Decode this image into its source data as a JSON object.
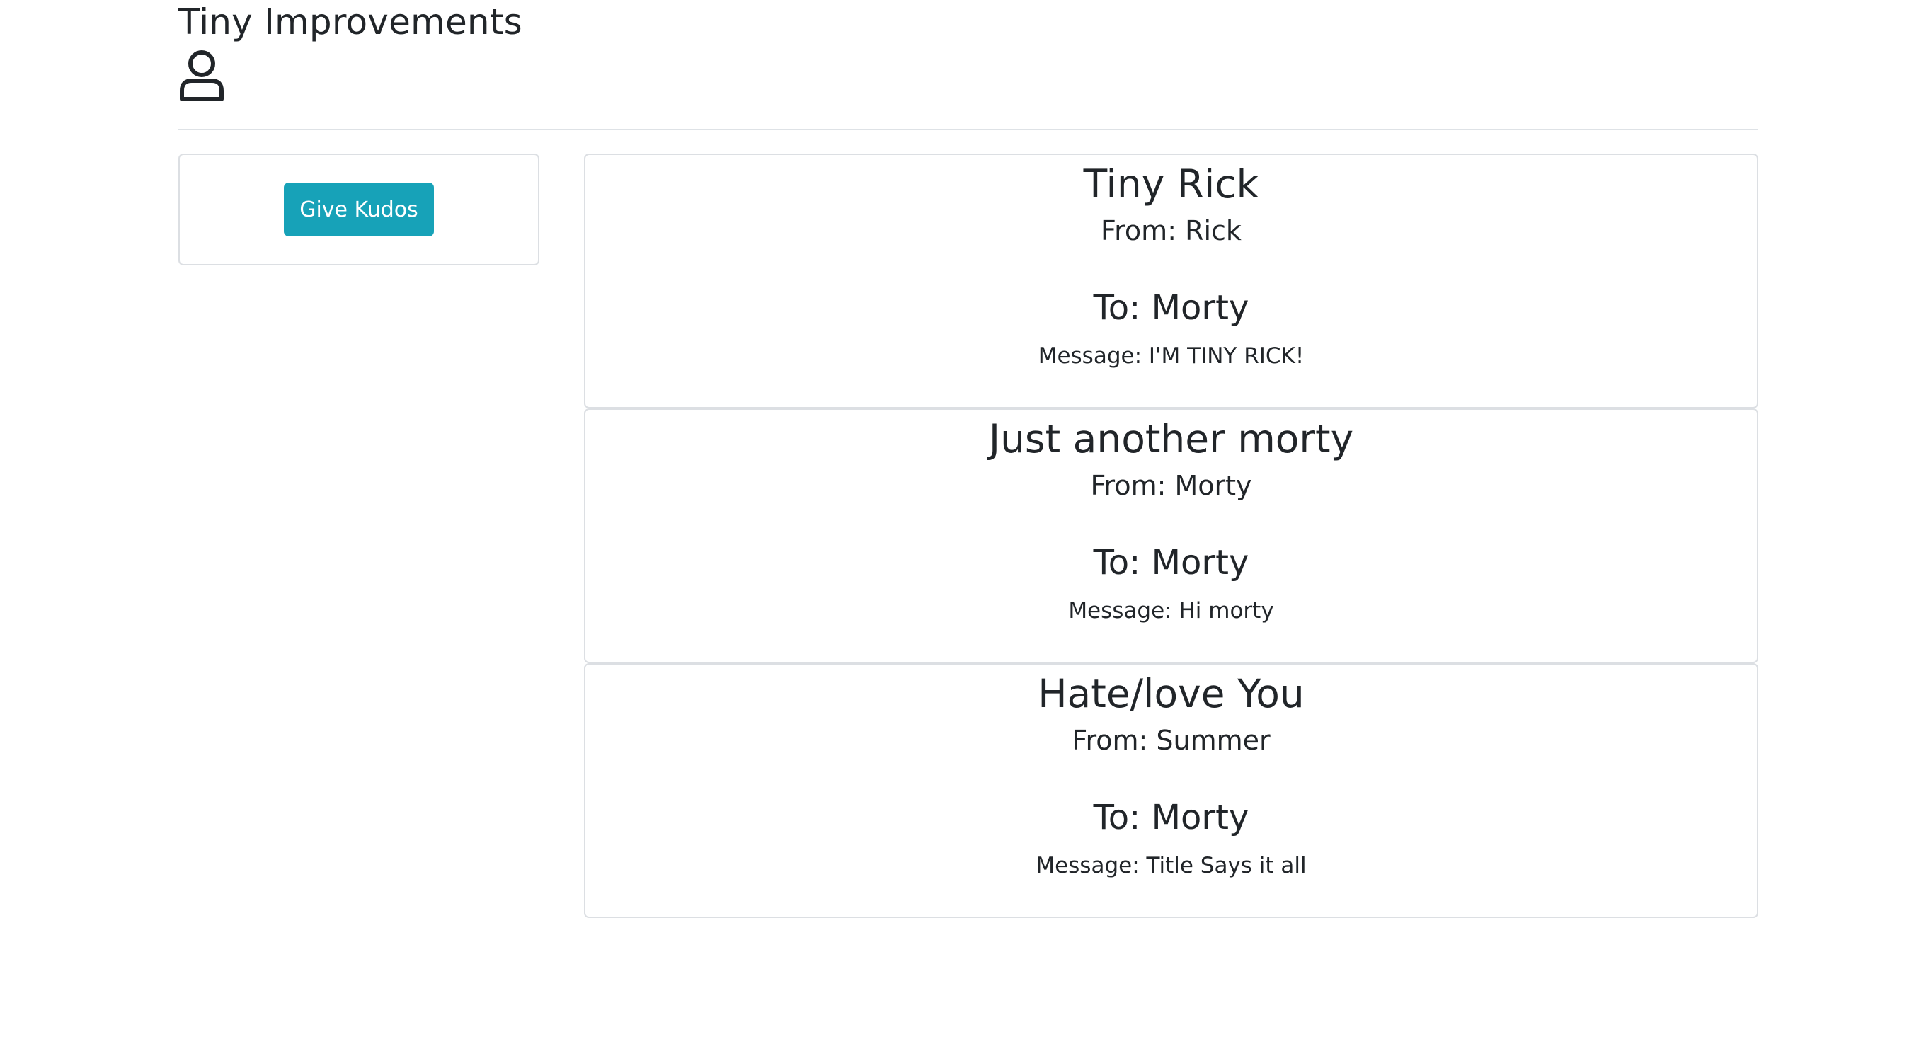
{
  "header": {
    "title": "Tiny Improvements",
    "user_icon": "user-icon"
  },
  "sidebar": {
    "give_kudos_label": "Give Kudos",
    "button_color": "#17a2b8"
  },
  "kudos": [
    {
      "title": "Tiny Rick",
      "from": "From: Rick",
      "to": "To: Morty",
      "message": "Message: I'M TINY RICK!"
    },
    {
      "title": "Just another morty",
      "from": "From: Morty",
      "to": "To: Morty",
      "message": "Message: Hi morty"
    },
    {
      "title": "Hate/love You",
      "from": "From: Summer",
      "to": "To: Morty",
      "message": "Message: Title Says it all"
    }
  ]
}
